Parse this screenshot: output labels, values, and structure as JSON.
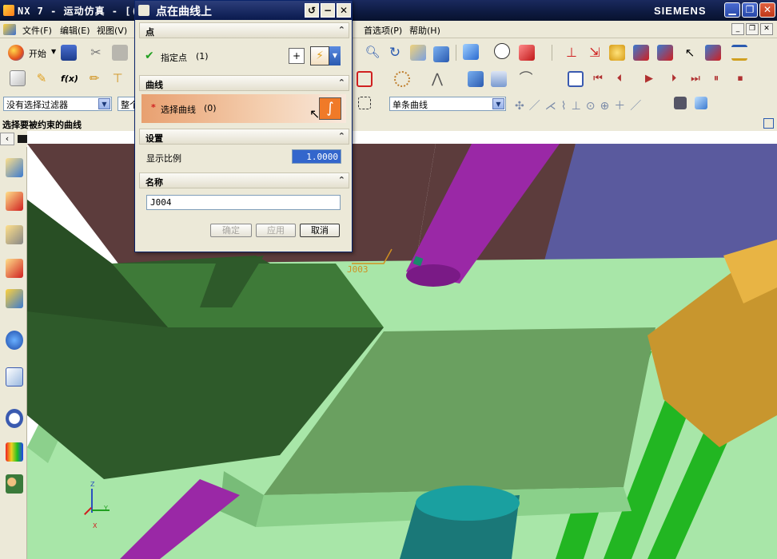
{
  "app": {
    "title": "NX 7 - 运动仿真 - [(",
    "brand": "SIEMENS"
  },
  "menubar": {
    "items": [
      "文件(F)",
      "编辑(E)",
      "视图(V)",
      "首选项(P)",
      "帮助(H)"
    ]
  },
  "toolbar": {
    "start_label": "开始",
    "filter_value": "没有选择过滤器",
    "scope_value": "整个",
    "curve_rule_value": "单条曲线"
  },
  "status": {
    "prompt": "选择要被约束的曲线"
  },
  "dialog": {
    "title": "点在曲线上",
    "sections": {
      "point": "点",
      "curve": "曲线",
      "settings": "设置",
      "name": "名称"
    },
    "point": {
      "label": "指定点",
      "count": "(1)"
    },
    "curve": {
      "asterisk": "*",
      "label": "选择曲线",
      "count": "(0)"
    },
    "settings": {
      "scale_label": "显示比例",
      "scale_value": "1.0000"
    },
    "name_value": "J004",
    "buttons": {
      "ok": "确定",
      "apply": "应用",
      "cancel": "取消"
    }
  },
  "viewport": {
    "joint_label": "J003",
    "triad": {
      "x": "X",
      "y": "Y",
      "z": "Z"
    }
  },
  "colors": {
    "title_bar": "#0d1a40",
    "dialog_bg": "#ece9d8",
    "pipe_magenta": "#9a28a6",
    "plate_green": "#a8e6a8",
    "block_dark_green": "#2e5a2a",
    "wall_brown": "#5c3c3c",
    "wall_blue": "#5a5a9e",
    "yellow_part": "#c8962e",
    "rail_green": "#22b622",
    "cylinder_teal": "#1a7878",
    "highlight_orange": "#e8a070"
  }
}
